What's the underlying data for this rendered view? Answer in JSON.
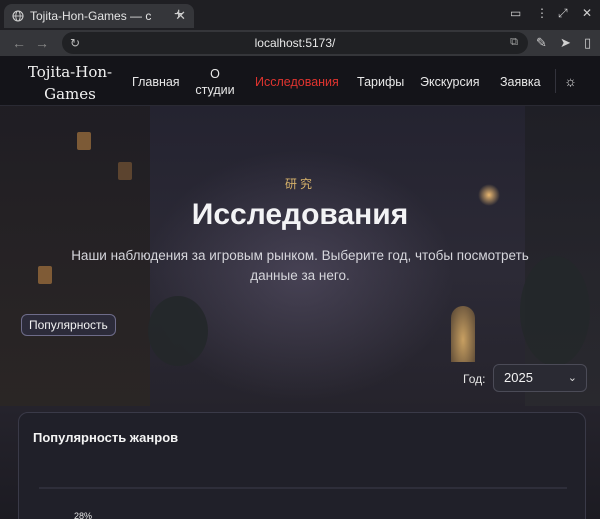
{
  "browser": {
    "tab_title": "Tojita-Hon-Games — c",
    "url": "localhost:5173/"
  },
  "site": {
    "logo": "Tojita-Hon-Games",
    "nav": [
      {
        "label": "Главная"
      },
      {
        "label": "О студии"
      },
      {
        "label": "Исследования",
        "active": true
      },
      {
        "label": "Тарифы"
      },
      {
        "label": "Экскурсия"
      },
      {
        "label": "Заявка"
      }
    ]
  },
  "hero": {
    "kanji": "研究",
    "title": "Исследования",
    "subtitle": "Наши наблюдения за игровым рынком. Выберите год, чтобы посмотреть данные за него.",
    "tag": "Популярность",
    "year_label": "Год:",
    "year_value": "2025"
  },
  "card": {
    "title": "Популярность жанров"
  },
  "chart_data": {
    "type": "bar",
    "title": "Популярность жанров",
    "visible_value_labels": [
      "28%"
    ]
  },
  "colors": {
    "accent_active_nav": "#e0342f",
    "kanji_gold": "#d7b26a",
    "header_bg": "#141419"
  }
}
